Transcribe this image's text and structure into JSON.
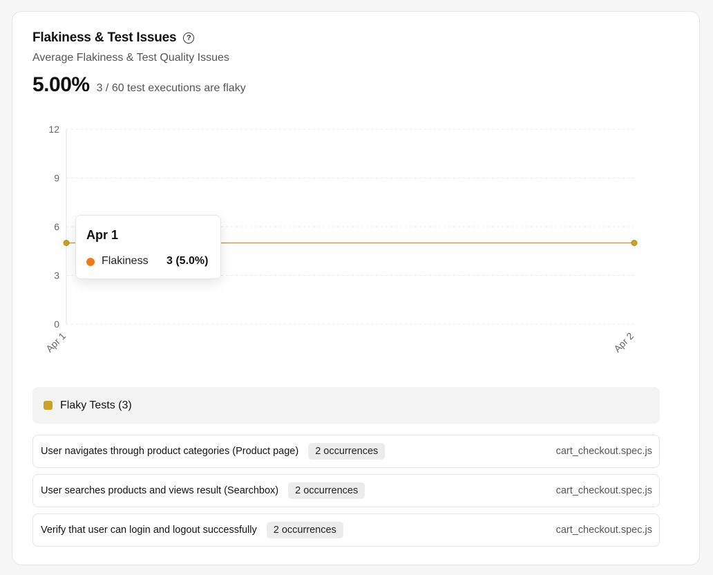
{
  "card": {
    "title": "Flakiness & Test Issues",
    "help_icon": "help-circle-icon",
    "help_glyph": "?",
    "subtitle": "Average Flakiness & Test Quality Issues",
    "kpi_value": "5.00%",
    "kpi_description": "3 / 60 test executions are flaky"
  },
  "chart_data": {
    "type": "line",
    "x": [
      "Apr 1",
      "Apr 2"
    ],
    "series": [
      {
        "name": "Flakiness",
        "values": [
          5,
          5
        ],
        "color": "#c9a227"
      }
    ],
    "yticks": [
      0,
      3,
      6,
      9,
      12
    ],
    "ylim": [
      0,
      12
    ],
    "grid": true,
    "xlabel": "",
    "ylabel": ""
  },
  "tooltip": {
    "date": "Apr 1",
    "series": "Flakiness",
    "value": "3 (5.0%)",
    "dot_color": "#f07a1a"
  },
  "flaky_tests": {
    "header": "Flaky Tests (3)",
    "swatch_color": "#c9a227",
    "items": [
      {
        "name": "User navigates through product categories (Product page)",
        "occurrences": "2 occurrences",
        "file": "cart_checkout.spec.js"
      },
      {
        "name": "User searches products and views result (Searchbox)",
        "occurrences": "2 occurrences",
        "file": "cart_checkout.spec.js"
      },
      {
        "name": "Verify that user can login and logout successfully",
        "occurrences": "2 occurrences",
        "file": "cart_checkout.spec.js"
      }
    ]
  }
}
